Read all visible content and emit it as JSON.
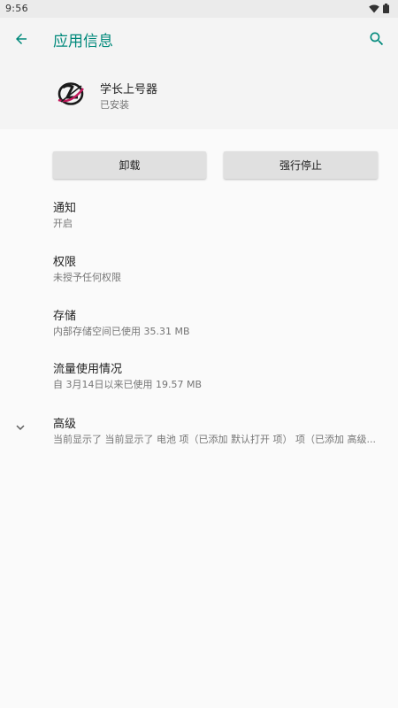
{
  "status_bar": {
    "time": "9:56",
    "icons": [
      "wifi-icon",
      "battery-icon"
    ]
  },
  "app_bar": {
    "title": "应用信息",
    "back_icon": "arrow-back-icon",
    "search_icon": "search-icon",
    "accent_color": "#00897b"
  },
  "app_header": {
    "name": "学长上号器",
    "status": "已安装"
  },
  "buttons": {
    "uninstall": "卸载",
    "force_stop": "强行停止"
  },
  "settings": [
    {
      "title": "通知",
      "summary": "开启"
    },
    {
      "title": "权限",
      "summary": "未授予任何权限"
    },
    {
      "title": "存储",
      "summary": "内部存储空间已使用 35.31 MB"
    },
    {
      "title": "流量使用情况",
      "summary": "自 3月14日以来已使用 19.57 MB"
    },
    {
      "title": "高级",
      "summary": "当前显示了 当前显示了 电池 项（已添加 默认打开 项） 项（已添加 高级..."
    }
  ]
}
